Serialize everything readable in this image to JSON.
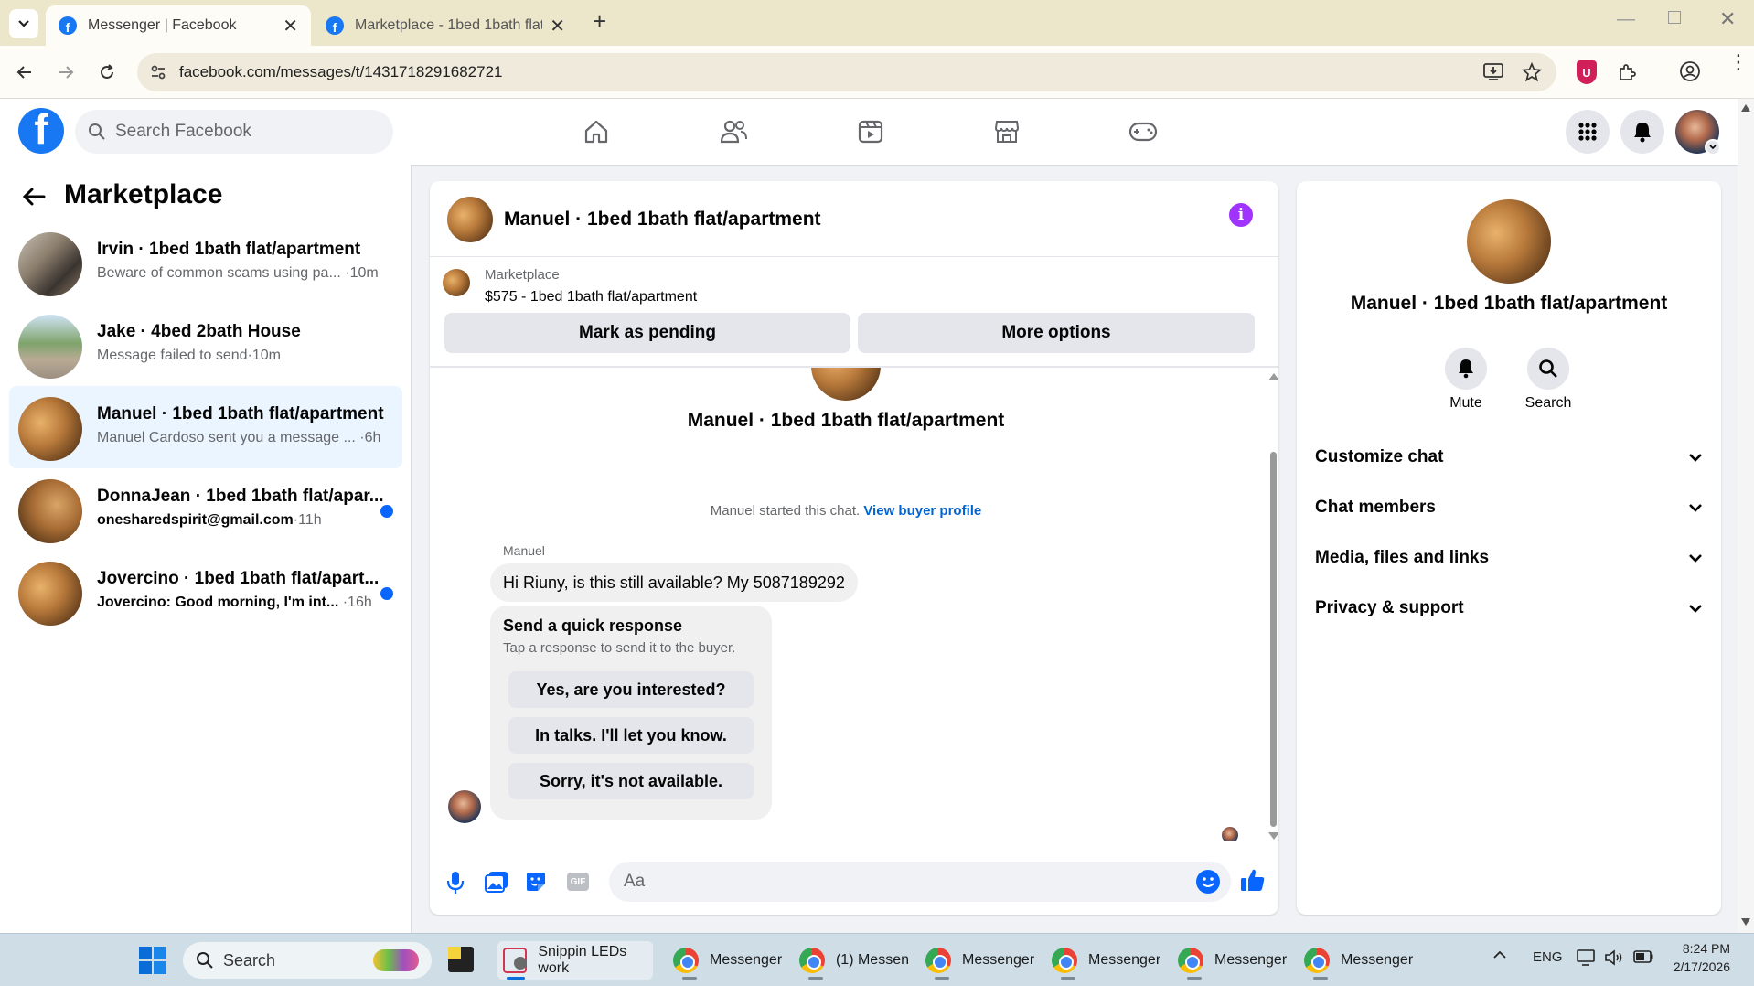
{
  "browser": {
    "tabs": [
      {
        "title": "Messenger | Facebook",
        "active": true
      },
      {
        "title": "Marketplace - 1bed 1bath flat/a",
        "active": false
      }
    ],
    "url": "facebook.com/messages/t/1431718291682721"
  },
  "fb": {
    "search_placeholder": "Search Facebook"
  },
  "sidebar": {
    "title": "Marketplace",
    "conversations": [
      {
        "name": "Irvin · 1bed 1bath flat/apartment",
        "snippet": "Beware of common scams using pa...",
        "time": "·10m",
        "unread": false,
        "selected": false
      },
      {
        "name": "Jake · 4bed 2bath House",
        "snippet": "Message failed to send",
        "time": "·10m",
        "unread": false,
        "selected": false
      },
      {
        "name": "Manuel · 1bed 1bath flat/apartment",
        "snippet": "Manuel Cardoso sent you a message ...",
        "time": "·6h",
        "unread": false,
        "selected": true
      },
      {
        "name": "DonnaJean · 1bed 1bath flat/apar...",
        "snippet": "onesharedspirit@gmail.com",
        "time": "·11h",
        "unread": true,
        "selected": false
      },
      {
        "name": "Jovercino · 1bed 1bath flat/apart...",
        "snippet": "Jovercino: Good morning, I'm int...",
        "time": "·16h",
        "unread": true,
        "selected": false
      }
    ]
  },
  "chat": {
    "header_title": "Manuel · 1bed 1bath flat/apartment",
    "listing_source": "Marketplace",
    "listing_line": "$575 - 1bed 1bath flat/apartment",
    "mark_pending_label": "Mark as pending",
    "more_options_label": "More options",
    "thread_title": "Manuel · 1bed 1bath flat/apartment",
    "started_text": "Manuel started this chat.",
    "view_profile_link": "View buyer profile",
    "sender_name": "Manuel",
    "message_text": "Hi Riuny, is this still available? My 5087189292",
    "quick_title": "Send a quick response",
    "quick_subtitle": "Tap a response to send it to the buyer.",
    "quick_responses": [
      "Yes, are you interested?",
      "In talks. I'll let you know.",
      "Sorry, it's not available."
    ],
    "composer_placeholder": "Aa"
  },
  "details": {
    "title": "Manuel · 1bed 1bath flat/apartment",
    "mute_label": "Mute",
    "search_label": "Search",
    "sections": [
      "Customize chat",
      "Chat members",
      "Media, files and links",
      "Privacy & support"
    ]
  },
  "taskbar": {
    "search_placeholder": "Search",
    "apps": [
      "Snippin LEDs work",
      "Messenger",
      "(1) Messen",
      "Messenger",
      "Messenger",
      "Messenger",
      "Messenger"
    ],
    "language": "ENG",
    "time": "8:24 PM",
    "date": "2/17/2026"
  },
  "colors": {
    "fb_blue": "#1877f2",
    "link_blue": "#0064d1",
    "unread_dot": "#0866ff",
    "info_purple": "#a033ff"
  }
}
